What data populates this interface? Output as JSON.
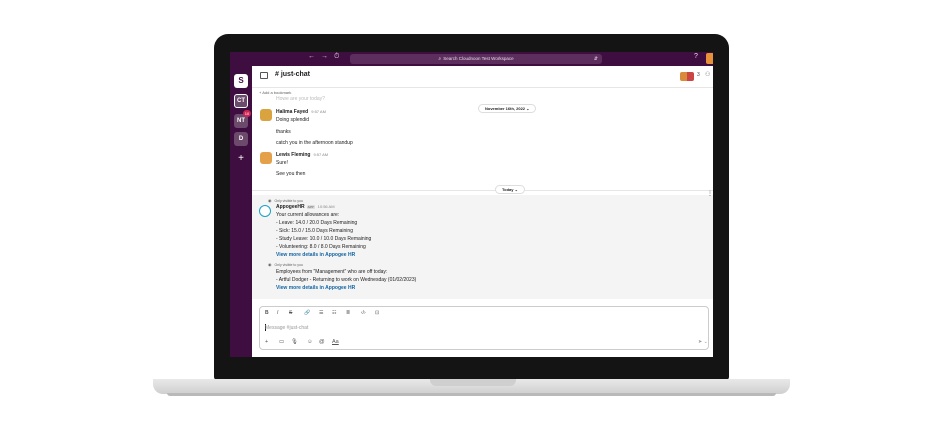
{
  "topbar": {
    "back": "←",
    "forward": "→",
    "history": "⏱",
    "search_placeholder": "Search Cloudnoon Test Workspace",
    "filter_icon": "⇵",
    "help": "?"
  },
  "rail": {
    "logo": "S",
    "workspaces": [
      "CT",
      "NT",
      "D"
    ],
    "nt_badge": "10",
    "add": "+"
  },
  "header": {
    "channel_name": "# just-chat",
    "member_count": "3",
    "bookmark_label": "+ Add a bookmark"
  },
  "messages": {
    "partial_line": "Howe are your today?",
    "date_pill_1": "November 16th, 2022 ⌄",
    "msg1": {
      "author": "Halima Fayed",
      "time": "9:57 AM",
      "lines": [
        "Doing splendid",
        "thanks",
        "catch you in the afternoon standup"
      ]
    },
    "msg2": {
      "author": "Lewis Fleming",
      "time": "9:57 AM",
      "lines": [
        "Sure!",
        "See you then"
      ]
    },
    "date_pill_2": "Today ⌄",
    "bot1": {
      "visibility": "Only visible to you",
      "author": "AppogeeHR",
      "tag": "APP",
      "time": "10:56 AM",
      "lines": [
        "Your current allowances are:",
        "- Leave: 14.0 / 20.0 Days Remaining",
        "- Sick: 15.0 / 15.0 Days Remaining",
        "- Study Leave: 10.0 / 10.0 Days Remaining",
        "- Volunteering: 8.0 / 8.0 Days Remaining"
      ],
      "link": "View more details in Appogee HR"
    },
    "bot2": {
      "visibility": "Only visible to you",
      "lines": [
        "Employees from \"Management\" who are off today:",
        "- Artful Dodger - Returning to work on Wednesday (01/02/2023)"
      ],
      "link": "View more details in Appogee HR"
    }
  },
  "composer": {
    "placeholder": "Message #just-chat",
    "format_buttons": [
      "B",
      "I",
      "S",
      "🔗",
      "☰",
      "☷",
      "≣",
      "‹/›",
      "⊡"
    ],
    "bottom_tools": [
      "+",
      "▭",
      "🎙",
      "☺",
      "@",
      "Aa"
    ],
    "send": "➤ ⌄"
  },
  "colors": {
    "sidebar": "#3f0e40",
    "link": "#1264a3",
    "badge": "#cd2553"
  }
}
